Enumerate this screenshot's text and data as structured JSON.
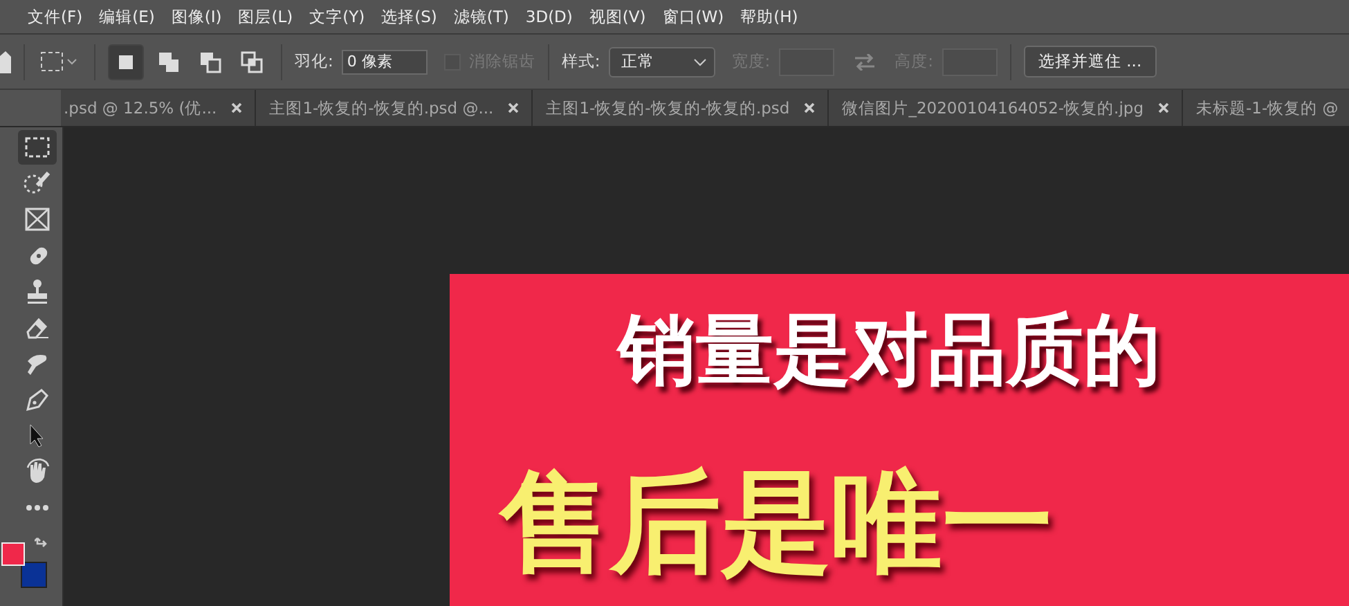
{
  "menu_bar": {
    "items": [
      "文件(F)",
      "编辑(E)",
      "图像(I)",
      "图层(L)",
      "文字(Y)",
      "选择(S)",
      "滤镜(T)",
      "3D(D)",
      "视图(V)",
      "窗口(W)",
      "帮助(H)"
    ]
  },
  "options_bar": {
    "selection_modes": [
      {
        "kind": "new",
        "selected": true
      },
      {
        "kind": "add",
        "selected": false
      },
      {
        "kind": "subtract",
        "selected": false
      },
      {
        "kind": "intersect",
        "selected": false
      }
    ],
    "feather": {
      "label": "羽化:",
      "value": "0 像素"
    },
    "anti_alias": {
      "label": "消除锯齿",
      "checked": false,
      "disabled": true
    },
    "style": {
      "label": "样式:",
      "value": "正常"
    },
    "width": {
      "label": "宽度:",
      "disabled": true
    },
    "height": {
      "label": "高度:",
      "disabled": true
    },
    "select_and_mask": "选择并遮住 ..."
  },
  "tabs": [
    {
      "label": ".psd @ 12.5% (优...",
      "selected": false
    },
    {
      "label": "主图1-恢复的-恢复的.psd @...",
      "selected": false
    },
    {
      "label": "主图1-恢复的-恢复的-恢复的.psd",
      "selected": false
    },
    {
      "label": "微信图片_20200104164052-恢复的.jpg",
      "selected": false
    },
    {
      "label": "未标题-1-恢复的 @",
      "selected": false
    }
  ],
  "tools": [
    {
      "kind": "marquee",
      "selected": true
    },
    {
      "kind": "quick-select",
      "selected": false
    },
    {
      "kind": "frame",
      "selected": false
    },
    {
      "kind": "healing",
      "selected": false
    },
    {
      "kind": "stamp",
      "selected": false
    },
    {
      "kind": "eraser",
      "selected": false
    },
    {
      "kind": "smudge",
      "selected": false
    },
    {
      "kind": "pen",
      "selected": false
    },
    {
      "kind": "arrow",
      "selected": false
    },
    {
      "kind": "rotate-view",
      "selected": false
    },
    {
      "kind": "more",
      "selected": false
    }
  ],
  "colors": {
    "foreground": {
      "color": "#f0284a"
    },
    "background": {
      "color": "#0a3296"
    }
  },
  "document": {
    "headline": "销量是对品质的",
    "subline": "售后是唯一"
  }
}
